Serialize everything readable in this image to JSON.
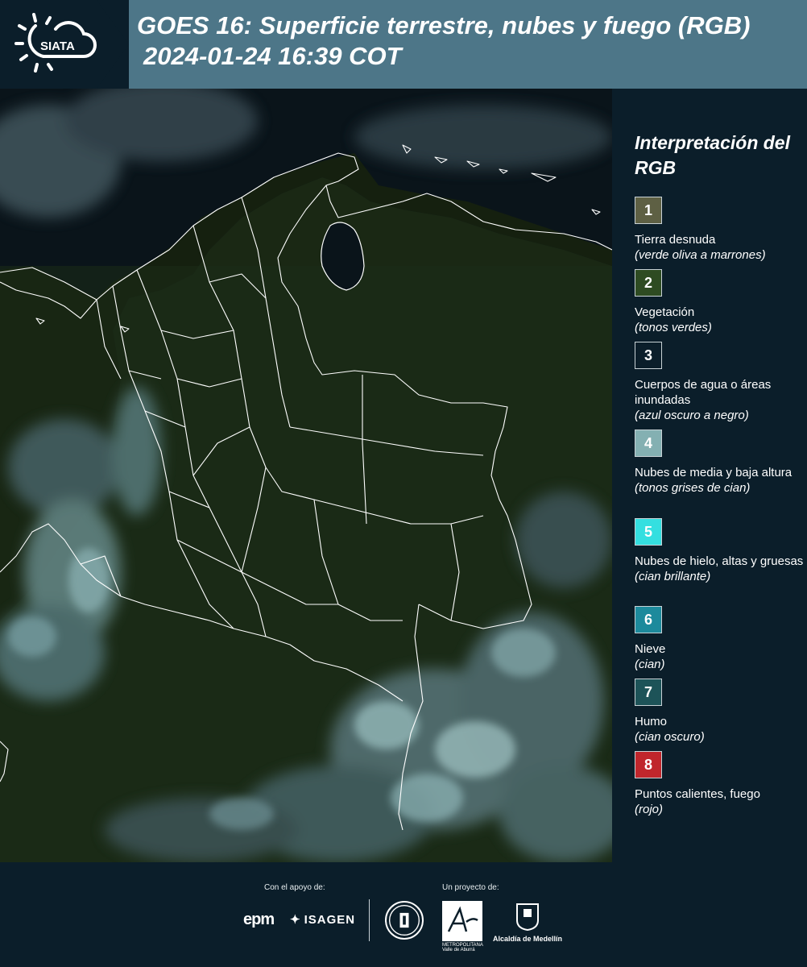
{
  "header": {
    "logo_text": "SIATA",
    "title_line1": "GOES 16: Superficie terrestre, nubes y fuego (RGB)",
    "title_line2": "2024-01-24 16:39 COT"
  },
  "legend": {
    "title": "Interpretación del RGB",
    "items": [
      {
        "num": "1",
        "color": "#5e6044",
        "label": "Tierra desnuda",
        "sub": "(verde oliva a marrones)"
      },
      {
        "num": "2",
        "color": "#2e4b22",
        "label": "Vegetación",
        "sub": "(tonos verdes)"
      },
      {
        "num": "3",
        "color": "#0b1e2a",
        "label": "Cuerpos de agua o áreas inundadas",
        "sub": "(azul oscuro a negro)"
      },
      {
        "num": "4",
        "color": "#84b0b2",
        "label": "Nubes de media y baja altura",
        "sub": "(tonos grises de cian)"
      },
      {
        "num": "5",
        "color": "#34dfe0",
        "label": "Nubes de hielo, altas y gruesas",
        "sub": "(cian brillante)"
      },
      {
        "num": "6",
        "color": "#1d8a9c",
        "label": "Nieve",
        "sub": "(cian)"
      },
      {
        "num": "7",
        "color": "#1d5358",
        "label": "Humo",
        "sub": "(cian oscuro)"
      },
      {
        "num": "8",
        "color": "#c0262c",
        "label": "Puntos calientes, fuego",
        "sub": "(rojo)"
      }
    ]
  },
  "footer": {
    "support_label": "Con el apoyo de:",
    "project_label": "Un proyecto de:",
    "epm": "epm",
    "isagen": "ISAGEN",
    "area_text": "METROPOLITANA Valle de Aburrá",
    "alcaldia": "Alcaldía de Medellín"
  }
}
